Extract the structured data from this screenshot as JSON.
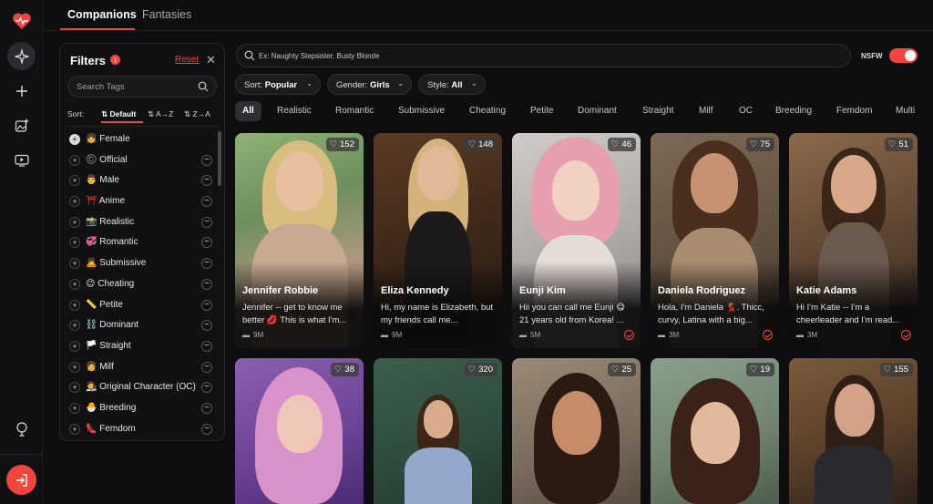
{
  "tabs": {
    "companions": "Companions",
    "fantasies": "Fantasies"
  },
  "filters": {
    "title": "Filters",
    "badge": "1",
    "reset": "Reset",
    "search_placeholder": "Search Tags",
    "sort_label": "Sort:",
    "sort_default": "Default",
    "sort_az": "A→Z",
    "sort_za": "Z→A",
    "tags": [
      {
        "emoji": "👧",
        "label": "Female"
      },
      {
        "emoji": "©️",
        "label": "Official"
      },
      {
        "emoji": "👨",
        "label": "Male"
      },
      {
        "emoji": "⛩️",
        "label": "Anime"
      },
      {
        "emoji": "📸",
        "label": "Realistic"
      },
      {
        "emoji": "💞",
        "label": "Romantic"
      },
      {
        "emoji": "🙇",
        "label": "Submissive"
      },
      {
        "emoji": "😉",
        "label": "Cheating"
      },
      {
        "emoji": "📏",
        "label": "Petite"
      },
      {
        "emoji": "⛓️",
        "label": "Dominant"
      },
      {
        "emoji": "🏳️",
        "label": "Straight"
      },
      {
        "emoji": "👩",
        "label": "Milf"
      },
      {
        "emoji": "🧑‍🎨",
        "label": "Original Character (OC)"
      },
      {
        "emoji": "🐣",
        "label": "Breeding"
      },
      {
        "emoji": "👠",
        "label": "Femdom"
      }
    ]
  },
  "search": {
    "placeholder": "Ex: Naughty Stepsister, Busty Blonde"
  },
  "nsfw": {
    "label": "NSFW",
    "enabled": true
  },
  "dropdowns": {
    "sort": {
      "label": "Sort:",
      "value": "Popular"
    },
    "gender": {
      "label": "Gender:",
      "value": "Girls"
    },
    "style": {
      "label": "Style:",
      "value": "All"
    }
  },
  "categories": [
    "All",
    "Realistic",
    "Romantic",
    "Submissive",
    "Cheating",
    "Petite",
    "Dominant",
    "Straight",
    "Milf",
    "OC",
    "Breeding",
    "Femdom",
    "Multi"
  ],
  "cards": [
    {
      "likes": "152",
      "name": "Jennifer Robbie",
      "desc": "Jennifer -- get to know me better 💋 This is what I'm...",
      "views": "9M",
      "verified": false
    },
    {
      "likes": "148",
      "name": "Eliza Kennedy",
      "desc": "Hi, my name is Elizabeth, but my friends call me...",
      "views": "9M",
      "verified": false
    },
    {
      "likes": "46",
      "name": "Eunji Kim",
      "desc": "Hii you can call me Eunji 😋 21 years old from Korea! ...",
      "views": "5M",
      "verified": true
    },
    {
      "likes": "75",
      "name": "Daniela Rodriguez",
      "desc": "Hola, I'm Daniela 💃. Thicc, curvy, Latina with a big...",
      "views": "3M",
      "verified": true
    },
    {
      "likes": "51",
      "name": "Katie Adams",
      "desc": "Hi I'm Katie -- I'm a cheerleader and I'm read...",
      "views": "3M",
      "verified": true
    },
    {
      "likes": "38"
    },
    {
      "likes": "320"
    },
    {
      "likes": "25"
    },
    {
      "likes": "19"
    },
    {
      "likes": "155"
    }
  ],
  "colors": {
    "accent": "#f2453d",
    "background": "#0e0e10"
  }
}
